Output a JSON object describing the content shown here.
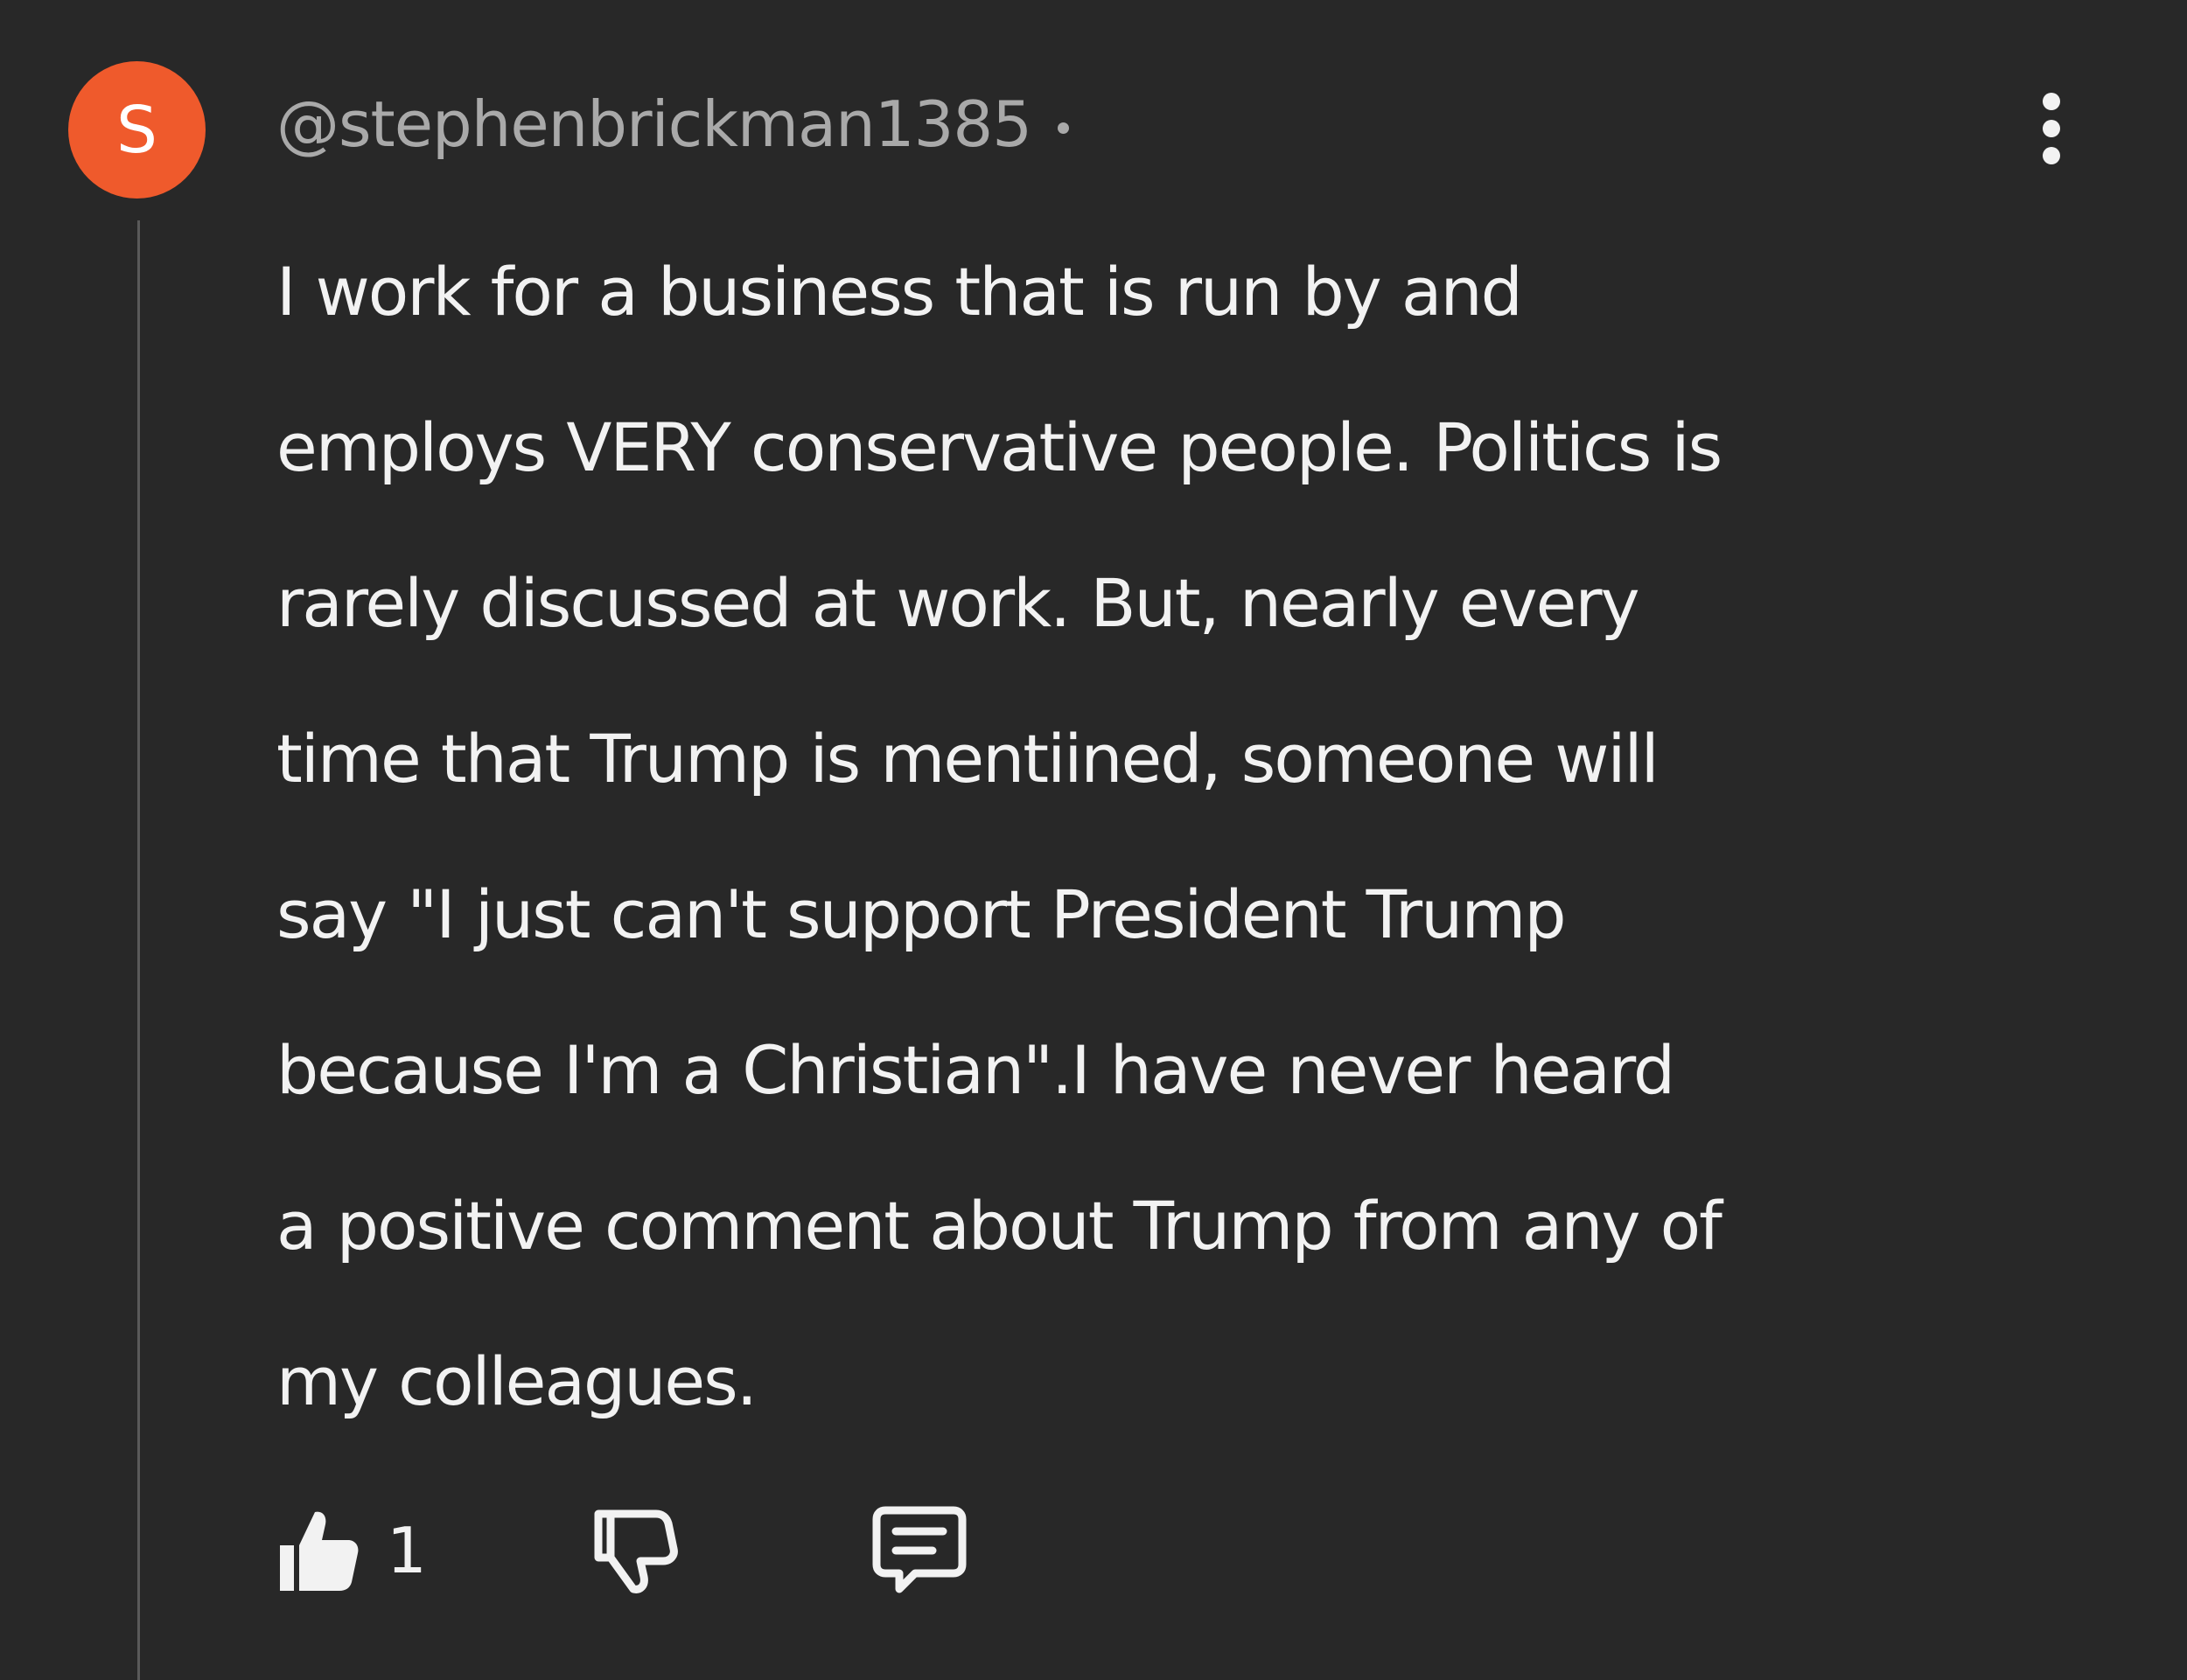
{
  "comment": {
    "avatar_letter": "S",
    "handle": "@stephenbrickman1385",
    "body_lines": [
      "I work for a business that is run by and",
      "employs VERY conservative people. Politics is",
      "rarely discussed at work. But, nearly every",
      "time that Trump is mentiined, someone will",
      "say \"I just can't support President Trump",
      "because I'm a Christian\".I have never heard",
      "a positive comment about Trump from any of",
      "my colleagues."
    ],
    "like_count": "1"
  },
  "icons": {
    "more": "more-vertical-icon",
    "like": "thumbs-up-icon",
    "dislike": "thumbs-down-icon",
    "reply": "comment-icon"
  },
  "colors": {
    "background": "#282828",
    "avatar": "#ef5a2c",
    "text": "#f2f2f2",
    "muted": "#a9a9a9"
  }
}
